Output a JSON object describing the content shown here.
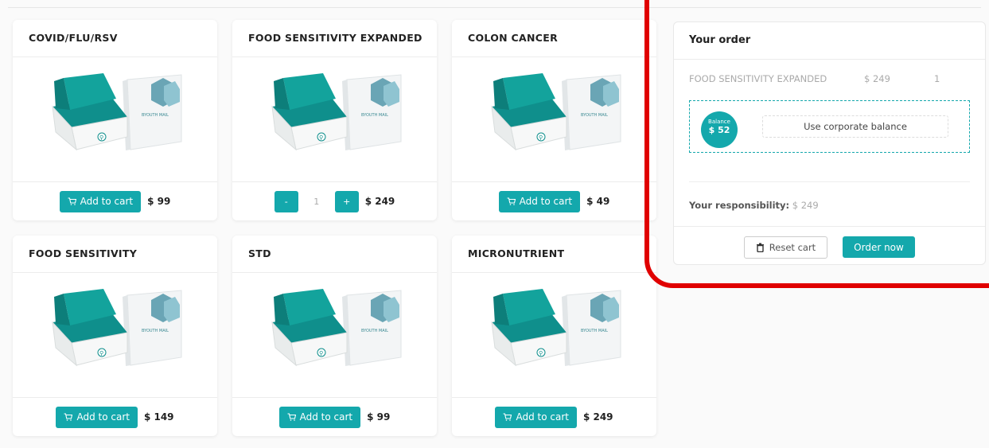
{
  "products": [
    {
      "name": "COVID/FLU/RSV",
      "button": "Add to cart",
      "price": "$ 99",
      "in_cart": false
    },
    {
      "name": "FOOD SENSITIVITY EXPANDED",
      "price": "$ 249",
      "in_cart": true,
      "minus": "-",
      "qty": "1",
      "plus": "+"
    },
    {
      "name": "COLON CANCER",
      "button": "Add to cart",
      "price": "$ 49",
      "in_cart": false
    },
    {
      "name": "FOOD SENSITIVITY",
      "button": "Add to cart",
      "price": "$ 149",
      "in_cart": false
    },
    {
      "name": "STD",
      "button": "Add to cart",
      "price": "$ 99",
      "in_cart": false
    },
    {
      "name": "MICRONUTRIENT",
      "button": "Add to cart",
      "price": "$ 249",
      "in_cart": false
    }
  ],
  "order": {
    "title": "Your order",
    "item_name": "FOOD SENSITIVITY EXPANDED",
    "item_price": "$ 249",
    "item_qty": "1",
    "balance_label": "Balance",
    "balance_amount": "$ 52",
    "use_balance": "Use corporate balance",
    "responsibility_label": "Your responsibility:",
    "responsibility_value": "$ 249",
    "reset": "Reset cart",
    "order_now": "Order now"
  },
  "brand_text": "BYOUTH MAIL",
  "colors": {
    "accent": "#14a8ac",
    "highlight": "#e00000"
  }
}
